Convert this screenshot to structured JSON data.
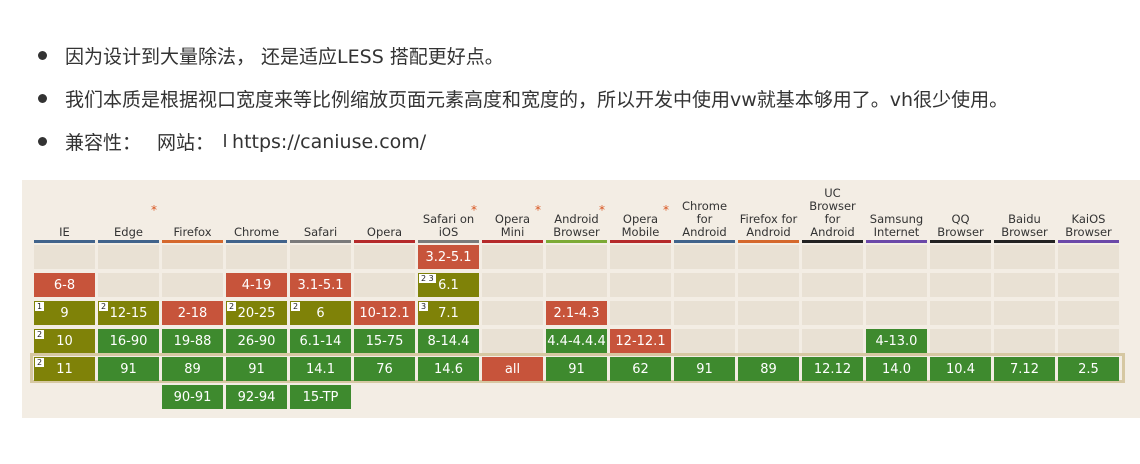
{
  "bullets": [
    {
      "text": "因为设计到大量除法， 还是适应LESS 搭配更好点。"
    },
    {
      "text": "我们本质是根据视口宽度来等比例缩放页面元素高度和宽度的，所以开发中使用vw就基本够用了。vh很少使用。"
    },
    {
      "label": "兼容性：",
      "site_label": "网站：",
      "url": "https://caniuse.com/"
    }
  ],
  "colors": {
    "support_full": "#3e8a2e",
    "support_partial": "#7f8208",
    "support_none": "#c7543b",
    "empty": "#e9e1d4",
    "panel_bg": "#f3ede4",
    "note_star": "#d9541e"
  },
  "browsers": [
    {
      "name": "IE",
      "bar": "#41638b",
      "cells": [
        {
          "row": 1,
          "text": "6-8",
          "status": "none"
        },
        {
          "row": 2,
          "text": "9",
          "status": "partial",
          "note": "1"
        },
        {
          "row": 3,
          "text": "10",
          "status": "partial",
          "note": "2"
        },
        {
          "row": 4,
          "text": "11",
          "status": "partial",
          "note": "2"
        }
      ]
    },
    {
      "name": "Edge",
      "star": "*",
      "bar": "#41638b",
      "cells": [
        {
          "row": 2,
          "text": "12-15",
          "status": "partial",
          "note": "2"
        },
        {
          "row": 3,
          "text": "16-90",
          "status": "full"
        },
        {
          "row": 4,
          "text": "91",
          "status": "full"
        }
      ]
    },
    {
      "name": "Firefox",
      "bar": "#d5682c",
      "cells": [
        {
          "row": 2,
          "text": "2-18",
          "status": "none"
        },
        {
          "row": 3,
          "text": "19-88",
          "status": "full"
        },
        {
          "row": 4,
          "text": "89",
          "status": "full"
        },
        {
          "row": 5,
          "text": "90-91",
          "status": "full"
        }
      ]
    },
    {
      "name": "Chrome",
      "bar": "#41638b",
      "cells": [
        {
          "row": 1,
          "text": "4-19",
          "status": "none"
        },
        {
          "row": 2,
          "text": "20-25",
          "status": "partial",
          "note": "2"
        },
        {
          "row": 3,
          "text": "26-90",
          "status": "full"
        },
        {
          "row": 4,
          "text": "91",
          "status": "full"
        },
        {
          "row": 5,
          "text": "92-94",
          "status": "full"
        }
      ]
    },
    {
      "name": "Safari",
      "bar": "#7a7a7a",
      "cells": [
        {
          "row": 1,
          "text": "3.1-5.1",
          "status": "none"
        },
        {
          "row": 2,
          "text": "6",
          "status": "partial",
          "note": "2"
        },
        {
          "row": 3,
          "text": "6.1-14",
          "status": "full"
        },
        {
          "row": 4,
          "text": "14.1",
          "status": "full"
        },
        {
          "row": 5,
          "text": "15-TP",
          "status": "full"
        }
      ]
    },
    {
      "name": "Opera",
      "bar": "#b52a2a",
      "cells": [
        {
          "row": 2,
          "text": "10-12.1",
          "status": "none"
        },
        {
          "row": 3,
          "text": "15-75",
          "status": "full"
        },
        {
          "row": 4,
          "text": "76",
          "status": "full"
        }
      ]
    },
    {
      "name": "Safari on iOS",
      "star": "*",
      "bar": "#7a7a7a",
      "cells": [
        {
          "row": 0,
          "text": "3.2-5.1",
          "status": "none"
        },
        {
          "row": 1,
          "text": "6.1",
          "status": "partial",
          "note": "2 3"
        },
        {
          "row": 2,
          "text": "7.1",
          "status": "partial",
          "note": "3"
        },
        {
          "row": 3,
          "text": "8-14.4",
          "status": "full"
        },
        {
          "row": 4,
          "text": "14.6",
          "status": "full"
        }
      ]
    },
    {
      "name": "Opera Mini",
      "star": "*",
      "bar": "#b52a2a",
      "cells": [
        {
          "row": 4,
          "text": "all",
          "status": "none"
        }
      ]
    },
    {
      "name": "Android Browser",
      "star": "*",
      "bar": "#7caa35",
      "cells": [
        {
          "row": 2,
          "text": "2.1-4.3",
          "status": "none"
        },
        {
          "row": 3,
          "text": "4.4-4.4.4",
          "status": "full"
        },
        {
          "row": 4,
          "text": "91",
          "status": "full"
        }
      ]
    },
    {
      "name": "Opera Mobile",
      "star": "*",
      "bar": "#b52a2a",
      "cells": [
        {
          "row": 3,
          "text": "12-12.1",
          "status": "none"
        },
        {
          "row": 4,
          "text": "62",
          "status": "full"
        }
      ]
    },
    {
      "name": "Chrome for Android",
      "bar": "#41638b",
      "cells": [
        {
          "row": 4,
          "text": "91",
          "status": "full"
        }
      ]
    },
    {
      "name": "Firefox for Android",
      "bar": "#d5682c",
      "cells": [
        {
          "row": 4,
          "text": "89",
          "status": "full"
        }
      ]
    },
    {
      "name": "UC Browser for Android",
      "bar": "#222222",
      "cells": [
        {
          "row": 4,
          "text": "12.12",
          "status": "full"
        }
      ]
    },
    {
      "name": "Samsung Internet",
      "bar": "#6b48a8",
      "cells": [
        {
          "row": 3,
          "text": "4-13.0",
          "status": "full"
        },
        {
          "row": 4,
          "text": "14.0",
          "status": "full"
        }
      ]
    },
    {
      "name": "QQ Browser",
      "bar": "#222222",
      "cells": [
        {
          "row": 4,
          "text": "10.4",
          "status": "full"
        }
      ]
    },
    {
      "name": "Baidu Browser",
      "bar": "#222222",
      "cells": [
        {
          "row": 4,
          "text": "7.12",
          "status": "full"
        }
      ]
    },
    {
      "name": "KaiOS Browser",
      "bar": "#6b48a8",
      "cells": [
        {
          "row": 4,
          "text": "2.5",
          "status": "full"
        }
      ]
    }
  ]
}
